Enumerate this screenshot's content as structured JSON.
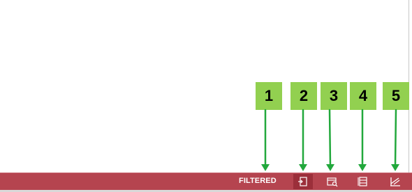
{
  "status_bar": {
    "filtered_label": "FILTERED",
    "buttons": [
      {
        "icon": "form-view-icon",
        "active": true
      },
      {
        "icon": "layout-view-icon",
        "active": false
      },
      {
        "icon": "datasheet-view-icon",
        "active": false
      },
      {
        "icon": "design-view-icon",
        "active": false
      }
    ]
  },
  "callouts": [
    "1",
    "2",
    "3",
    "4",
    "5"
  ],
  "colors": {
    "status_bar": "#b5444f",
    "callout_fill": "#92d050",
    "arrow": "#22a83c"
  }
}
